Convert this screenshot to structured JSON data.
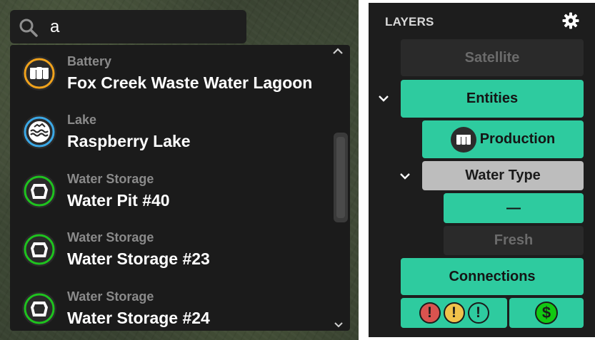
{
  "search": {
    "value": "a",
    "icon": "search-icon"
  },
  "results": [
    {
      "category": "Battery",
      "name": "Fox Creek Waste Water Lagoon",
      "icon": "battery-icon",
      "ring_color": "#f0a21c"
    },
    {
      "category": "Lake",
      "name": "Raspberry Lake",
      "icon": "lake-icon",
      "ring_color": "#3ba8e6"
    },
    {
      "category": "Water Storage",
      "name": "Water Pit #40",
      "icon": "water-storage-icon",
      "ring_color": "#1fc21f"
    },
    {
      "category": "Water Storage",
      "name": "Water Storage #23",
      "icon": "water-storage-icon",
      "ring_color": "#1fc21f"
    },
    {
      "category": "Water Storage",
      "name": "Water Storage #24",
      "icon": "water-storage-icon",
      "ring_color": "#1fc21f"
    }
  ],
  "layers": {
    "title": "LAYERS",
    "satellite": "Satellite",
    "entities": "Entities",
    "production": "Production",
    "water_type": "Water Type",
    "water_type_blank": "—",
    "fresh": "Fresh",
    "connections": "Connections",
    "alert_high": "!",
    "alert_medium": "!",
    "alert_low": "!",
    "money": "$"
  },
  "colors": {
    "teal": "#2ecb9f",
    "alert_red": "#d9534f",
    "alert_yellow": "#f0c24b",
    "alert_teal": "#2ecb9f",
    "money_green": "#12c812"
  }
}
